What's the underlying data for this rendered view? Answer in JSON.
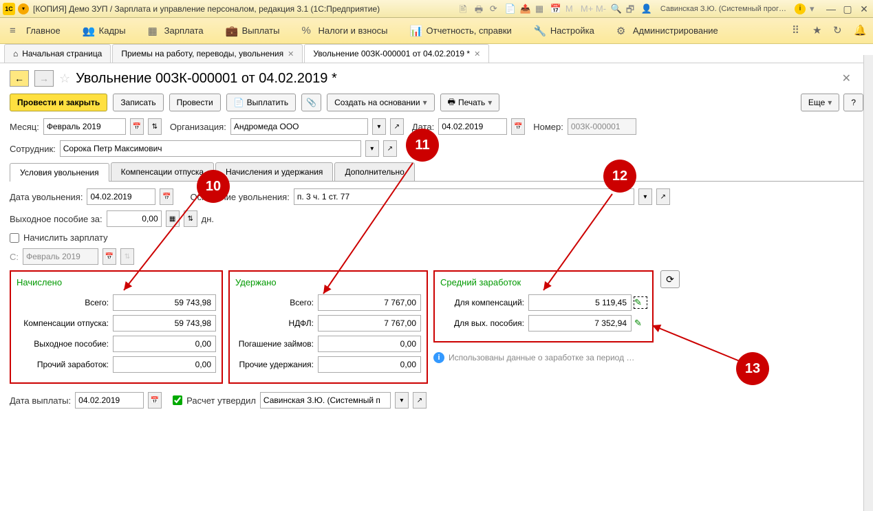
{
  "titlebar": {
    "app_icon": "1C",
    "title": "[КОПИЯ] Демо ЗУП / Зарплата и управление персоналом, редакция 3.1  (1С:Предприятие)",
    "user": "Савинская З.Ю. (Системный прог…",
    "m_labels": [
      "M",
      "M+",
      "M-"
    ]
  },
  "mainmenu": {
    "items": [
      {
        "icon": "≡",
        "label": "Главное"
      },
      {
        "icon": "👥",
        "label": "Кадры"
      },
      {
        "icon": "▦",
        "label": "Зарплата"
      },
      {
        "icon": "💼",
        "label": "Выплаты"
      },
      {
        "icon": "%",
        "label": "Налоги и взносы"
      },
      {
        "icon": "📊",
        "label": "Отчетность, справки"
      },
      {
        "icon": "🔧",
        "label": "Настройка"
      },
      {
        "icon": "⚙",
        "label": "Администрирование"
      }
    ]
  },
  "tabs": {
    "home": "Начальная страница",
    "t1": "Приемы на работу, переводы, увольнения",
    "t2": "Увольнение 00ЗК-000001 от 04.02.2019 *"
  },
  "page": {
    "title": "Увольнение 00ЗК-000001 от 04.02.2019 *"
  },
  "toolbar": {
    "post_close": "Провести и закрыть",
    "save": "Записать",
    "post": "Провести",
    "pay": "Выплатить",
    "create_from": "Создать на основании",
    "print": "Печать",
    "more": "Еще",
    "help": "?"
  },
  "form": {
    "month_lbl": "Месяц:",
    "month_val": "Февраль 2019",
    "org_lbl": "Организация:",
    "org_val": "Андромеда ООО",
    "date_lbl": "Дата:",
    "date_val": "04.02.2019",
    "num_lbl": "Номер:",
    "num_val": "00ЗК-000001",
    "emp_lbl": "Сотрудник:",
    "emp_val": "Сорока Петр Максимович",
    "dismiss_date_lbl": "Дата увольнения:",
    "dismiss_date_val": "04.02.2019",
    "reason_lbl": "Основание увольнения:",
    "reason_val": "п. 3 ч. 1 ст. 77",
    "severance_lbl": "Выходное пособие за:",
    "severance_val": "0,00",
    "severance_unit": "дн.",
    "calc_salary_lbl": "Начислить зарплату",
    "from_lbl": "С:",
    "from_val": "Февраль 2019",
    "paydate_lbl": "Дата выплаты:",
    "paydate_val": "04.02.2019",
    "approved_lbl": "Расчет утвердил",
    "approved_val": "Савинская З.Ю. (Системный п"
  },
  "innertabs": {
    "t1": "Условия увольнения",
    "t2": "Компенсации отпуска",
    "t3": "Начисления и удержания",
    "t4": "Дополнительно"
  },
  "sum": {
    "accrued": {
      "title": "Начислено",
      "total_lbl": "Всего:",
      "total_val": "59 743,98",
      "vac_lbl": "Компенсации отпуска:",
      "vac_val": "59 743,98",
      "sev_lbl": "Выходное пособие:",
      "sev_val": "0,00",
      "oth_lbl": "Прочий заработок:",
      "oth_val": "0,00"
    },
    "withheld": {
      "title": "Удержано",
      "total_lbl": "Всего:",
      "total_val": "7 767,00",
      "ndfl_lbl": "НДФЛ:",
      "ndfl_val": "7 767,00",
      "loan_lbl": "Погашение займов:",
      "loan_val": "0,00",
      "oth_lbl": "Прочие удержания:",
      "oth_val": "0,00"
    },
    "avg": {
      "title": "Средний заработок",
      "comp_lbl": "Для компенсаций:",
      "comp_val": "5 119,45",
      "sev_lbl": "Для вых. пособия:",
      "sev_val": "7 352,94",
      "info": "Использованы данные о заработке за период …"
    }
  },
  "callouts": {
    "c10": "10",
    "c11": "11",
    "c12": "12",
    "c13": "13"
  }
}
